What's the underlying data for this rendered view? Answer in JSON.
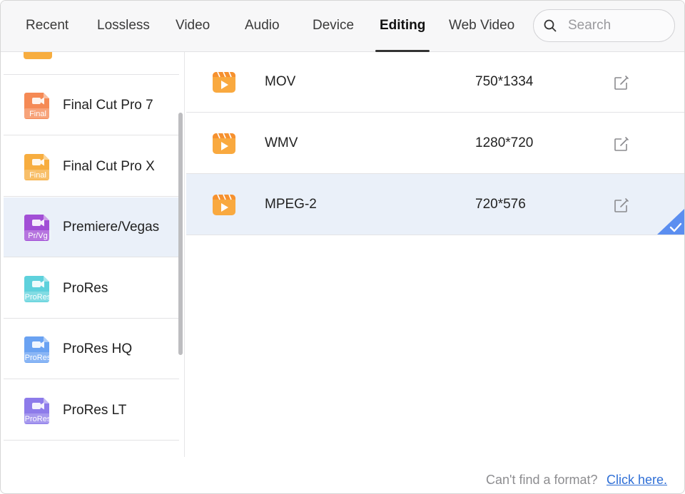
{
  "tabs": [
    {
      "label": "Recent"
    },
    {
      "label": "Lossless"
    },
    {
      "label": "Video"
    },
    {
      "label": "Audio"
    },
    {
      "label": "Device"
    },
    {
      "label": "Editing",
      "active": true
    },
    {
      "label": "Web Video"
    }
  ],
  "search": {
    "placeholder": "Search",
    "value": ""
  },
  "sidebar": {
    "items": [
      {
        "label": "Final Cut Pro 7",
        "badge": "Final",
        "icon": "final-cut-icon",
        "color": "#f58a55"
      },
      {
        "label": "Final Cut Pro X",
        "badge": "Final",
        "icon": "final-cut-icon",
        "color": "#f7ad3f"
      },
      {
        "label": "Premiere/Vegas",
        "badge": "Pr/Vg",
        "icon": "premiere-vegas-icon",
        "color": "#a24fd6",
        "selected": true
      },
      {
        "label": "ProRes",
        "badge": "ProRes",
        "icon": "prores-icon",
        "color": "#5ed1dc"
      },
      {
        "label": "ProRes HQ",
        "badge": "ProRes",
        "icon": "prores-icon",
        "color": "#6aa2f2"
      },
      {
        "label": "ProRes LT",
        "badge": "ProRes",
        "icon": "prores-icon",
        "color": "#8d7bea"
      }
    ]
  },
  "formats": [
    {
      "name": "MOV",
      "resolution": "750*1334",
      "icon": "video-file-icon"
    },
    {
      "name": "WMV",
      "resolution": "1280*720",
      "icon": "video-file-icon"
    },
    {
      "name": "MPEG-2",
      "resolution": "720*576",
      "icon": "video-file-icon",
      "selected": true
    }
  ],
  "footer": {
    "question": "Can't find a format?",
    "link": " Click here."
  },
  "colors": {
    "accent": "#2f6fd6",
    "selection": "#eaf0f9",
    "check": "#5b8ef0"
  }
}
